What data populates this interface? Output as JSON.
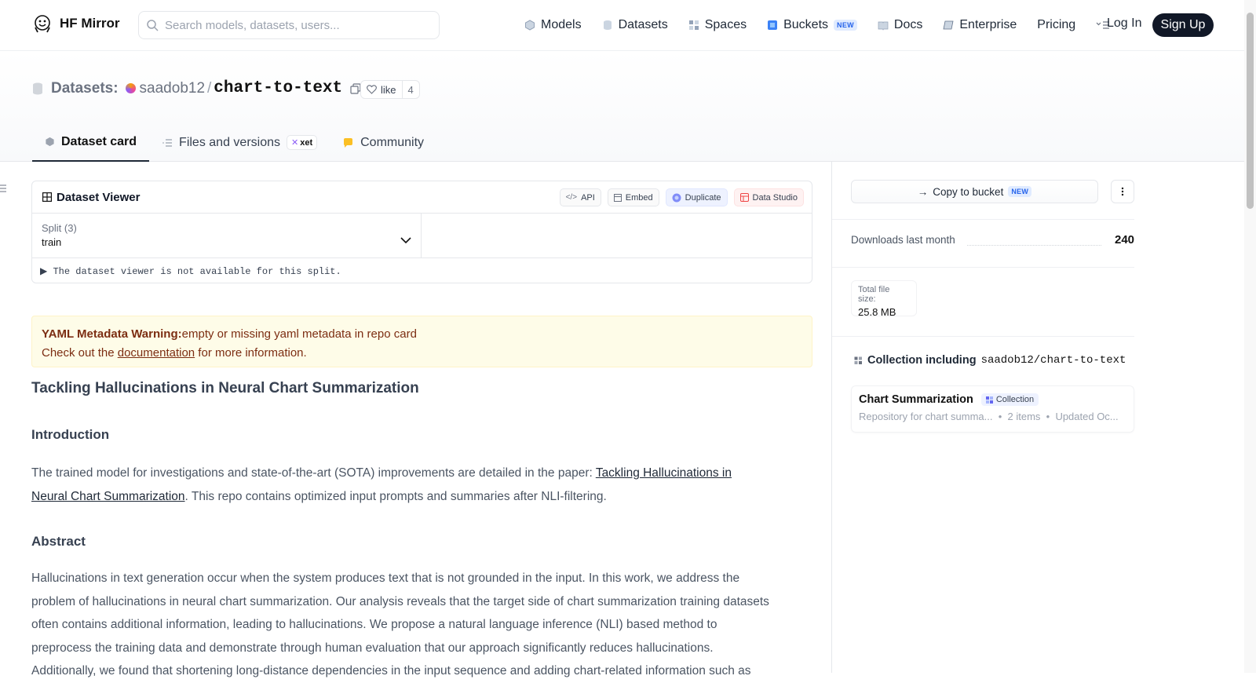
{
  "nav": {
    "brand": "HF Mirror",
    "search_placeholder": "Search models, datasets, users...",
    "links": [
      {
        "label": "Models",
        "icon": "cube-icon"
      },
      {
        "label": "Datasets",
        "icon": "database-icon"
      },
      {
        "label": "Spaces",
        "icon": "grid-icon"
      },
      {
        "label": "Buckets",
        "icon": "bucket-icon",
        "badge": "NEW"
      },
      {
        "label": "Docs",
        "icon": "book-icon"
      },
      {
        "label": "Enterprise",
        "icon": "enterprise-icon"
      },
      {
        "label": "Pricing"
      }
    ],
    "login": "Log In",
    "signup": "Sign Up"
  },
  "header": {
    "section": "Datasets:",
    "user": "saadob12",
    "sep": "/",
    "repo": "chart-to-text",
    "like_label": "like",
    "like_count": "4",
    "tabs": [
      {
        "label": "Dataset card",
        "active": true
      },
      {
        "label": "Files and versions",
        "badge": "xet"
      },
      {
        "label": "Community"
      }
    ]
  },
  "viewer": {
    "title": "Dataset Viewer",
    "buttons": {
      "api": "API",
      "embed": "Embed",
      "duplicate": "Duplicate",
      "data_studio": "Data Studio"
    },
    "split_label": "Split (3)",
    "split_value": "train",
    "unavailable": "The dataset viewer is not available for this split."
  },
  "warning": {
    "title": "YAML Metadata Warning:",
    "text": "empty or missing yaml metadata in repo card",
    "line2_pre": "Check out the ",
    "link": "documentation",
    "line2_post": " for more information."
  },
  "card": {
    "title": "Tackling Hallucinations in Neural Chart Summarization",
    "intro_heading": "Introduction",
    "intro_pre": "The trained model for investigations and state-of-the-art (SOTA) improvements are detailed in the paper: ",
    "intro_link": "Tackling Hallucinations in Neural Chart Summarization",
    "intro_post": ". This repo contains optimized input prompts and summaries after NLI-filtering.",
    "abstract_heading": "Abstract",
    "abstract": "Hallucinations in text generation occur when the system produces text that is not grounded in the input. In this work, we address the problem of hallucinations in neural chart summarization. Our analysis reveals that the target side of chart summarization training datasets often contains additional information, leading to hallucinations. We propose a natural language inference (NLI) based method to preprocess the training data and demonstrate through human evaluation that our approach significantly reduces hallucinations. Additionally, we found that shortening long-distance dependencies in the input sequence and adding chart-related information such as"
  },
  "sidebar": {
    "copy_to_bucket": "Copy to bucket",
    "copy_badge": "NEW",
    "downloads_label": "Downloads last month",
    "downloads_value": "240",
    "size_label": "Total file size:",
    "size_value": "25.8 MB",
    "collection_label": "Collection including",
    "collection_repo": "saadob12/chart-to-text",
    "collection_card": {
      "name": "Chart Summarization",
      "tag": "Collection",
      "description": "Repository for chart summa...",
      "items": "2 items",
      "updated": "Updated Oc..."
    }
  }
}
